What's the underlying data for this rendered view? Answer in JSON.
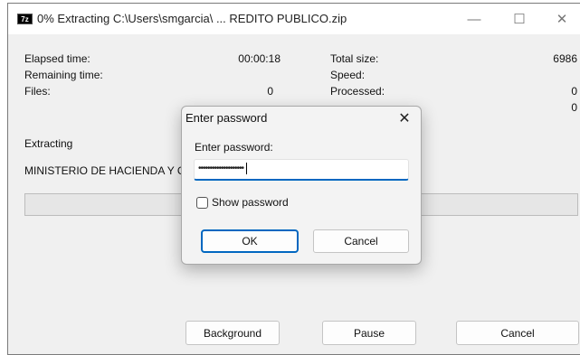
{
  "window": {
    "icon_text": "7z",
    "title": "0% Extracting C:\\Users\\smgarcia\\ ... REDITO PUBLICO.zip",
    "minimize_glyph": "—",
    "maximize_glyph": "☐",
    "close_glyph": "✕"
  },
  "stats": {
    "elapsed_label": "Elapsed time:",
    "elapsed_value": "00:00:18",
    "remaining_label": "Remaining time:",
    "files_label": "Files:",
    "files_value": "0",
    "total_size_label": "Total size:",
    "total_size_value": "6986",
    "speed_label": "Speed:",
    "processed_label": "Processed:",
    "processed_value": "0",
    "row4_value": "0"
  },
  "status": {
    "action": "Extracting",
    "current_file": "MINISTERIO DE HACIENDA Y C",
    "progress_fraction": 0.0
  },
  "buttons": {
    "background": "Background",
    "pause": "Pause",
    "cancel": "Cancel"
  },
  "password_dialog": {
    "title": "Enter password",
    "close_glyph": "✕",
    "prompt": "Enter password:",
    "masked_value": "••••••••••••••••••••",
    "show_password_label": "Show password",
    "show_password_checked": false,
    "ok_label": "OK",
    "cancel_label": "Cancel",
    "accent_color": "#0067c0"
  }
}
